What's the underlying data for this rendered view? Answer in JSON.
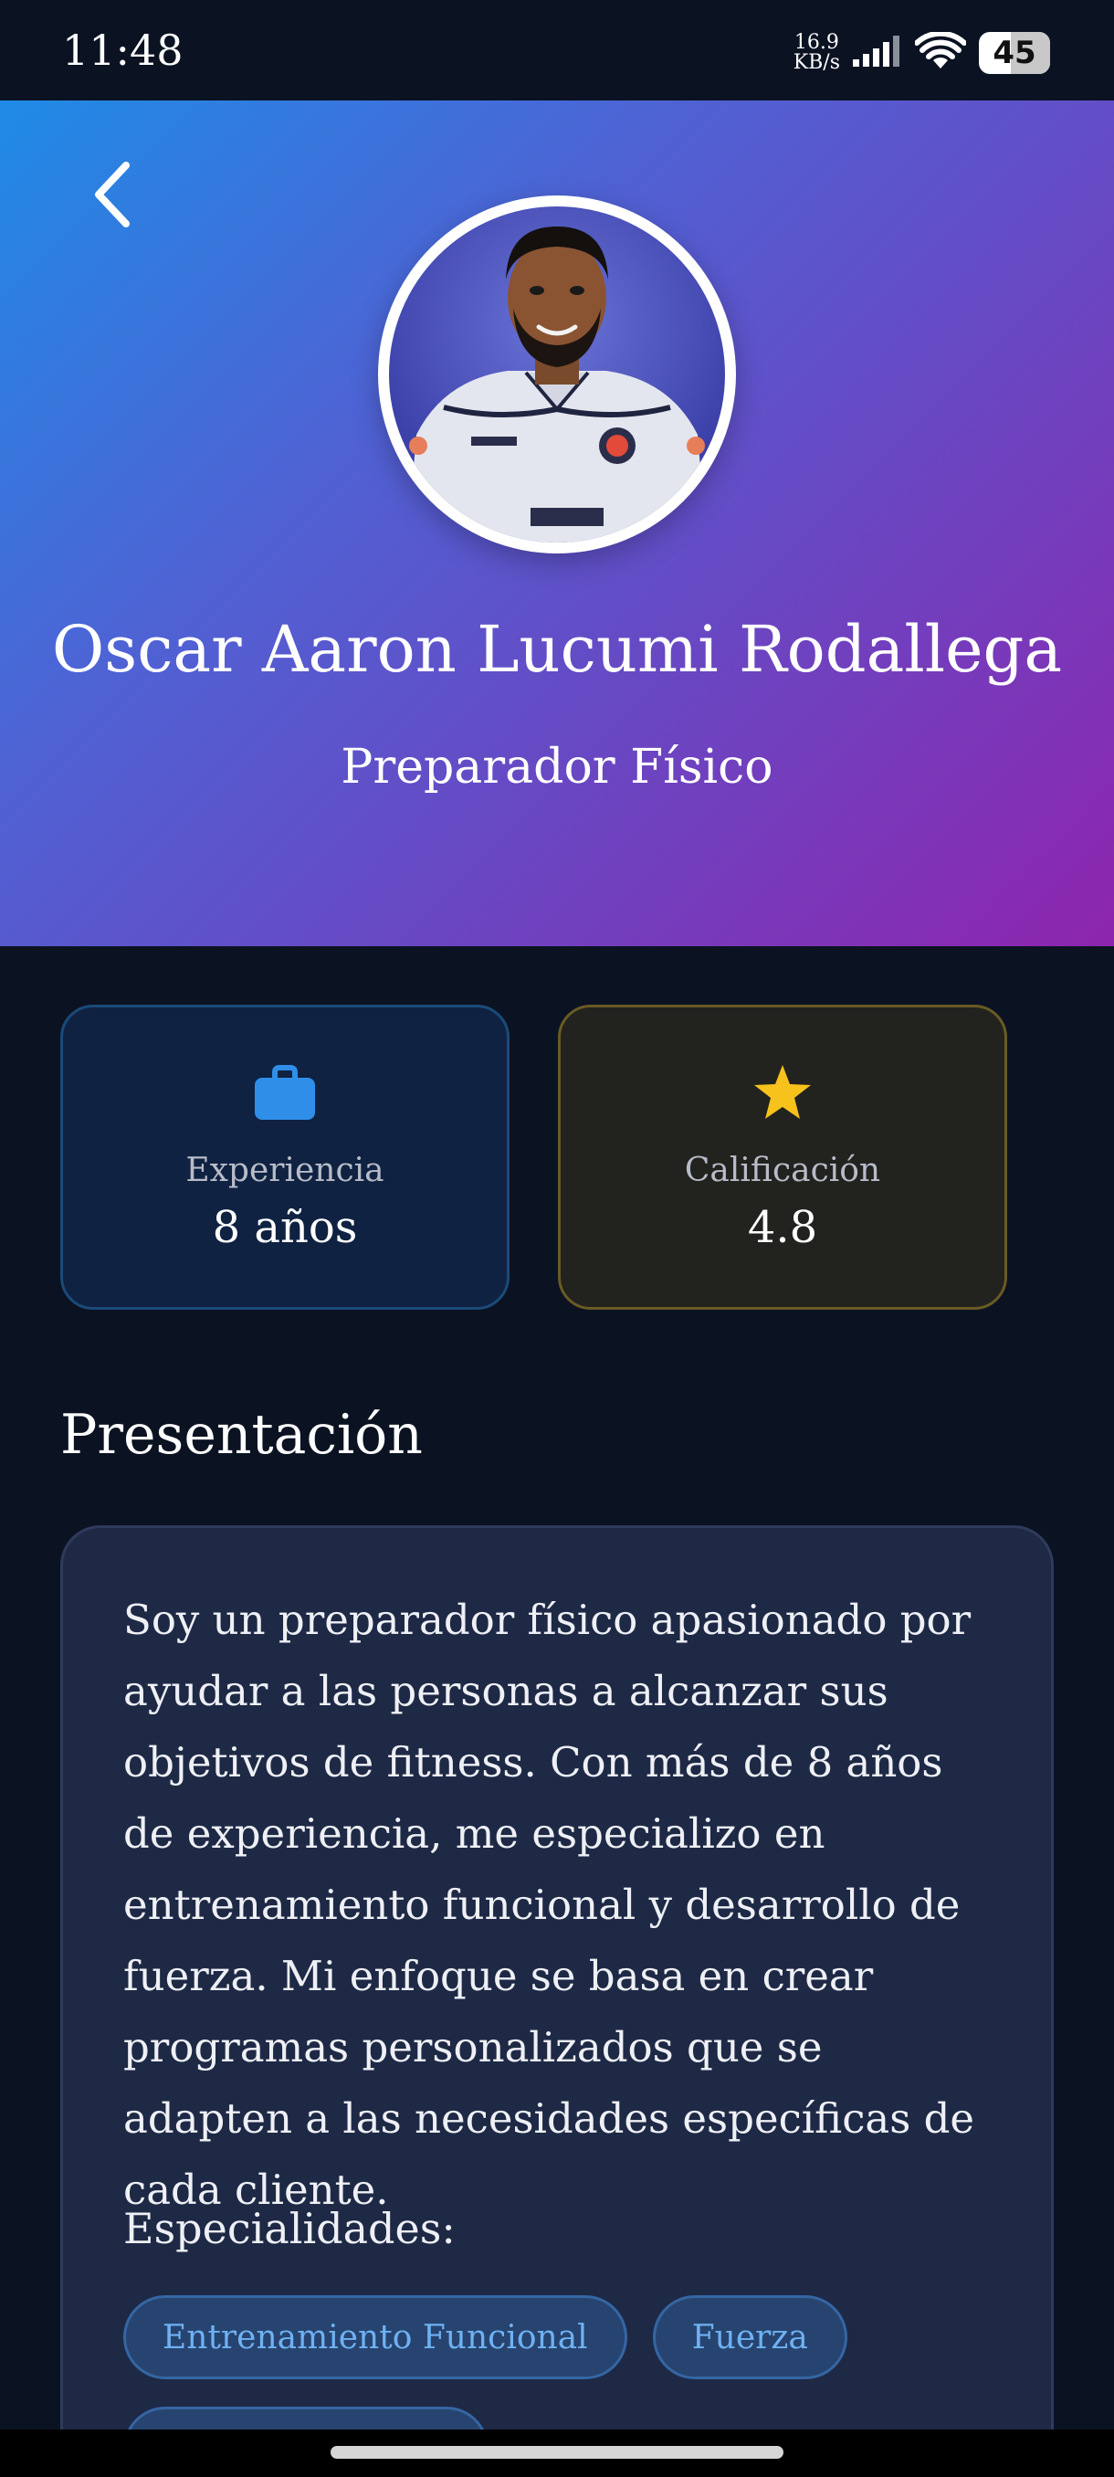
{
  "status_bar": {
    "time": "11:48",
    "net_speed_value": "16.9",
    "net_speed_unit": "KB/s",
    "battery": "45"
  },
  "profile": {
    "name": "Oscar Aaron Lucumi Rodallega",
    "role": "Preparador Físico"
  },
  "stats": {
    "experience": {
      "label": "Experiencia",
      "value": "8 años",
      "icon": "briefcase-icon",
      "color": "#2f8fe8"
    },
    "rating": {
      "label": "Calificación",
      "value": "4.8",
      "icon": "star-icon",
      "color": "#f6c21b"
    }
  },
  "presentation": {
    "title": "Presentación",
    "text": "Soy un preparador físico apasionado por ayudar a las personas a alcanzar sus objetivos de fitness. Con más de 8 años de experiencia, me especializo en entrenamiento funcional y desarrollo de fuerza. Mi enfoque se basa en crear programas personalizados que se adapten a las necesidades específicas de cada cliente.",
    "specialties_title": "Especialidades:",
    "specialties": [
      "Entrenamiento Funcional",
      "Fuerza",
      ""
    ]
  }
}
